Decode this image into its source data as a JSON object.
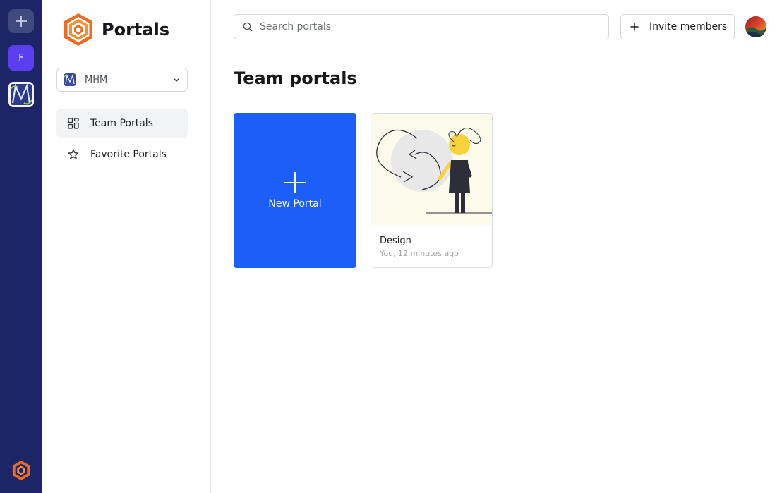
{
  "rail": {
    "workspace_f_initial": "F"
  },
  "sidebar": {
    "brand_title": "Portals",
    "workspace_name": "MHM",
    "nav": [
      {
        "label": "Team Portals",
        "active": true
      },
      {
        "label": "Favorite Portals",
        "active": false
      }
    ]
  },
  "header": {
    "search_placeholder": "Search portals",
    "invite_label": "Invite members"
  },
  "main": {
    "title": "Team portals",
    "new_portal_label": "New Portal",
    "portals": [
      {
        "name": "Design",
        "meta": "You, 12 minutes ago"
      }
    ]
  },
  "colors": {
    "rail_bg": "#1c2566",
    "accent_blue": "#1b5ff8",
    "workspace_purple": "#5a3ff0",
    "brand_orange": "#f26a21"
  }
}
